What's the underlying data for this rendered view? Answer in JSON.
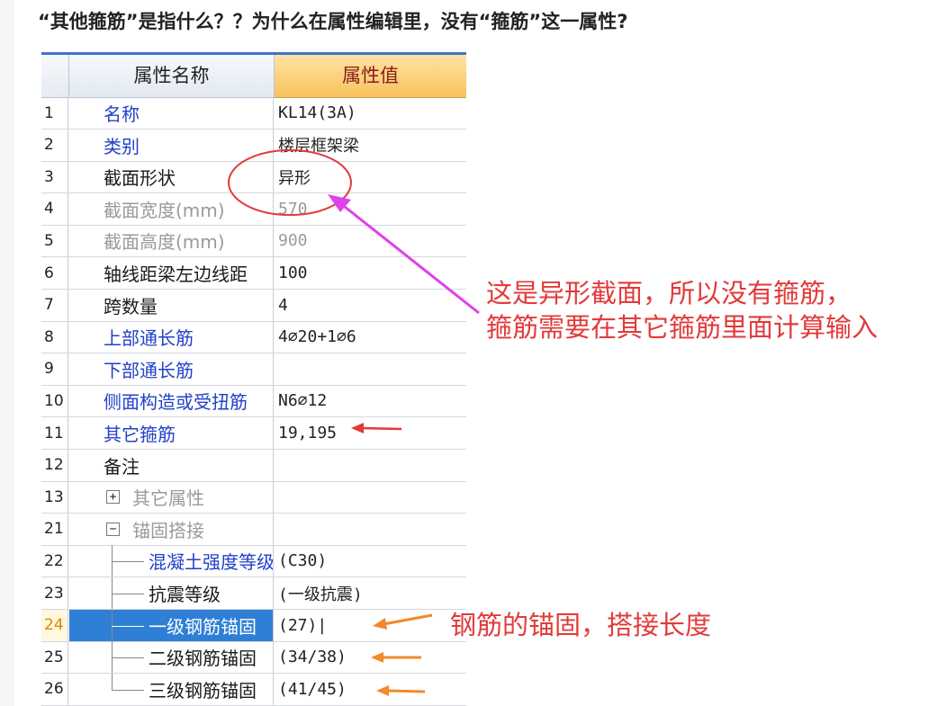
{
  "question": "“其他箍筋”是指什么？？为什么在属性编辑里，没有“箍筋”这一属性?",
  "table": {
    "header": {
      "name": "属性名称",
      "value": "属性值"
    },
    "rows": [
      {
        "num": "1",
        "name": "名称",
        "value": "KL14(3A)",
        "name_color": "blue"
      },
      {
        "num": "2",
        "name": "类别",
        "value": "楼层框架梁",
        "name_color": "blue"
      },
      {
        "num": "3",
        "name": "截面形状",
        "value": "异形",
        "name_color": "black"
      },
      {
        "num": "4",
        "name": "截面宽度(mm)",
        "value": "570",
        "name_color": "gray",
        "value_color": "gray"
      },
      {
        "num": "5",
        "name": "截面高度(mm)",
        "value": "900",
        "name_color": "gray",
        "value_color": "gray"
      },
      {
        "num": "6",
        "name": "轴线距梁左边线距",
        "value": "100",
        "name_color": "black"
      },
      {
        "num": "7",
        "name": "跨数量",
        "value": "4",
        "name_color": "black"
      },
      {
        "num": "8",
        "name": "上部通长筋",
        "value": "4⌀20+1⌀6",
        "name_color": "blue"
      },
      {
        "num": "9",
        "name": "下部通长筋",
        "value": "",
        "name_color": "blue"
      },
      {
        "num": "10",
        "name": "侧面构造或受扭筋",
        "value": "N6⌀12",
        "name_color": "blue"
      },
      {
        "num": "11",
        "name": "其它箍筋",
        "value": "19,195",
        "name_color": "blue"
      },
      {
        "num": "12",
        "name": "备注",
        "value": "",
        "name_color": "black"
      },
      {
        "num": "13",
        "name": "其它属性",
        "value": "",
        "name_color": "gray",
        "expander": "+"
      },
      {
        "num": "21",
        "name": "锚固搭接",
        "value": "",
        "name_color": "gray",
        "expander": "−"
      },
      {
        "num": "22",
        "name": "混凝土强度等级",
        "value": "(C30)",
        "name_color": "blue",
        "child": true
      },
      {
        "num": "23",
        "name": "抗震等级",
        "value": "(一级抗震)",
        "name_color": "black",
        "child": true
      },
      {
        "num": "24",
        "name": "一级钢筋锚固",
        "value": "(27)|",
        "name_color": "white",
        "child": true,
        "selected": true
      },
      {
        "num": "25",
        "name": "二级钢筋锚固",
        "value": "(34/38)",
        "name_color": "black",
        "child": true
      },
      {
        "num": "26",
        "name": "三级钢筋锚固",
        "value": "(41/45)",
        "name_color": "black",
        "child": true
      }
    ]
  },
  "annotations": {
    "note1_line1": "这是异形截面，所以没有箍筋，",
    "note1_line2": "箍筋需要在其它箍筋里面计算输入",
    "note2": "钢筋的锚固，搭接长度",
    "colors": {
      "red": "#e23a3a",
      "magenta": "#e040e8",
      "orange": "#f08a2a"
    }
  }
}
